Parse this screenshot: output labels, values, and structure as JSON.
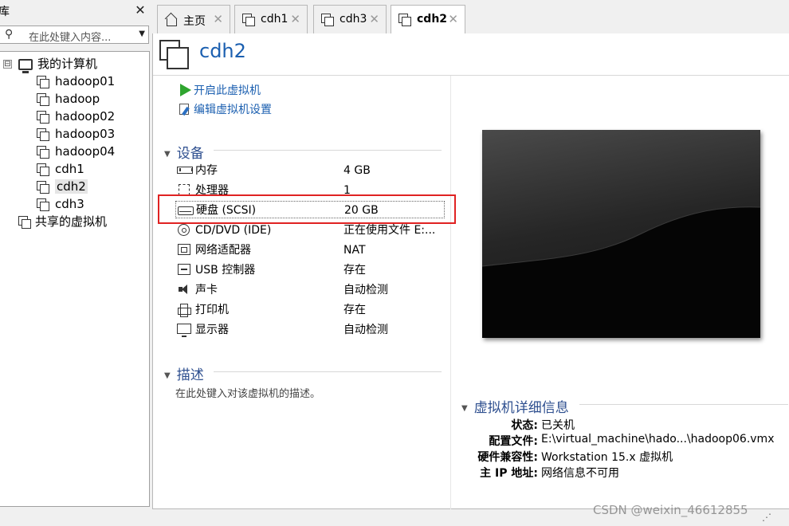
{
  "library": {
    "title": "库",
    "close_glyph": "✕",
    "search_placeholder": "在此处键入内容...",
    "search_icon": "search-icon",
    "tree": {
      "root_label": "我的计算机",
      "expander": "⊟",
      "vms": [
        "hadoop01",
        "hadoop",
        "hadoop02",
        "hadoop03",
        "hadoop04",
        "cdh1",
        "cdh2",
        "cdh3"
      ],
      "selected": "cdh2",
      "shared_label": "共享的虚拟机"
    }
  },
  "tabs": [
    {
      "label": "主页",
      "icon": "home-icon"
    },
    {
      "label": "cdh1",
      "icon": "vm-icon"
    },
    {
      "label": "cdh3",
      "icon": "vm-icon"
    },
    {
      "label": "cdh2",
      "icon": "vm-icon",
      "active": true
    }
  ],
  "tab_close_glyph": "✕",
  "vm": {
    "name": "cdh2",
    "actions": {
      "power_on": "开启此虚拟机",
      "edit_settings": "编辑虚拟机设置"
    },
    "devices_title": "设备",
    "devices": [
      {
        "name": "内存",
        "value": "4 GB",
        "icon": "memory-icon"
      },
      {
        "name": "处理器",
        "value": "1",
        "icon": "processor-icon"
      },
      {
        "name": "硬盘 (SCSI)",
        "value": "20 GB",
        "icon": "hard-disk-icon"
      },
      {
        "name": "CD/DVD (IDE)",
        "value": "正在使用文件 E:...",
        "icon": "cd-dvd-icon"
      },
      {
        "name": "网络适配器",
        "value": "NAT",
        "icon": "network-adapter-icon"
      },
      {
        "name": "USB 控制器",
        "value": "存在",
        "icon": "usb-icon"
      },
      {
        "name": "声卡",
        "value": "自动检测",
        "icon": "sound-card-icon"
      },
      {
        "name": "打印机",
        "value": "存在",
        "icon": "printer-icon"
      },
      {
        "name": "显示器",
        "value": "自动检测",
        "icon": "display-icon"
      }
    ],
    "description_title": "描述",
    "description_placeholder": "在此处键入对该虚拟机的描述。",
    "details_title": "虚拟机详细信息",
    "details": [
      {
        "key": "状态:",
        "value": "已关机"
      },
      {
        "key": "配置文件:",
        "value": "E:\\virtual_machine\\hado...\\hadoop06.vmx"
      },
      {
        "key": "硬件兼容性:",
        "value": "Workstation 15.x 虚拟机"
      },
      {
        "key": "主 IP 地址:",
        "value": "网络信息不可用"
      }
    ]
  },
  "watermark": "CSDN @weixin_46612855",
  "colors": {
    "accent_blue": "#1b5fb0",
    "section_blue": "#2e4f8f",
    "highlight_red": "#e02222",
    "play_green": "#2fa52f"
  }
}
